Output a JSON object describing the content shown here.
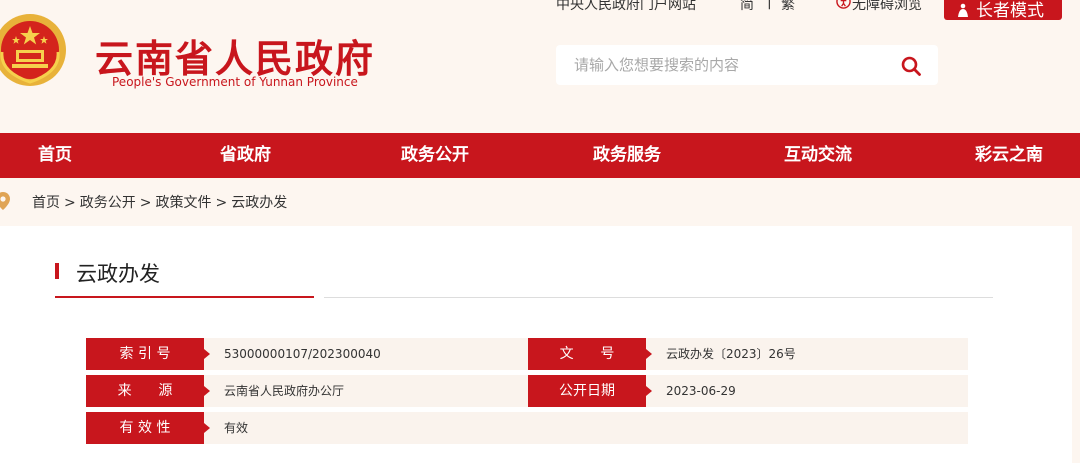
{
  "header": {
    "title": "云南省人民政府",
    "subtitle": "People's Government of Yunnan Province",
    "portal_link": "中央人民政府门户网站",
    "simplified": "简",
    "divider": "|",
    "traditional": "繁",
    "accessibility": "无障碍浏览",
    "elder_mode": "长者模式",
    "search_placeholder": "请输入您想要搜索的内容"
  },
  "nav": {
    "items": [
      {
        "label": "首页"
      },
      {
        "label": "省政府"
      },
      {
        "label": "政务公开"
      },
      {
        "label": "政务服务"
      },
      {
        "label": "互动交流"
      },
      {
        "label": "彩云之南"
      }
    ]
  },
  "breadcrumb": {
    "items": [
      "首页",
      "政务公开",
      "政策文件",
      "云政办发"
    ],
    "separator": ">"
  },
  "section": {
    "title": "云政办发"
  },
  "meta": {
    "index_label": "索 引 号",
    "index_value": "53000000107/202300040",
    "doc_no_label": "文      号",
    "doc_no_value": "云政办发〔2023〕26号",
    "source_label": "来      源",
    "source_value": "云南省人民政府办公厅",
    "date_label": "公开日期",
    "date_value": "2023-06-29",
    "validity_label": "有 效 性",
    "validity_value": "有效"
  },
  "colors": {
    "brand_red": "#c8161d",
    "page_bg": "#fdf6f0",
    "row_bg": "#faf3ed"
  },
  "icons": [
    "national-emblem-icon",
    "accessibility-icon",
    "elder-person-icon",
    "search-icon",
    "location-pin-icon"
  ]
}
